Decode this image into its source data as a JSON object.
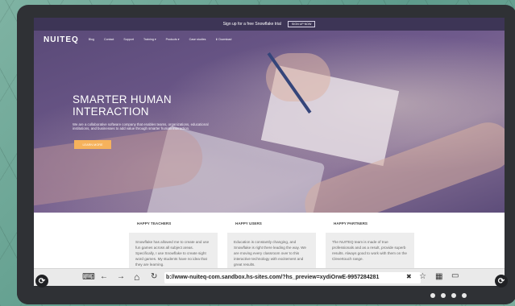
{
  "announcement": {
    "text": "Sign up for a free Snowflake trial",
    "button": "SIGN UP NOW"
  },
  "nav": {
    "logo": "NUITEQ",
    "items": [
      "Blog",
      "Contact",
      "Support",
      "Training ▾",
      "Products ▾",
      "Case studies",
      "⬇ Download"
    ]
  },
  "hero": {
    "title_line1": "SMARTER HUMAN",
    "title_line2": "INTERACTION",
    "description": "We are a collaborative software company that enables teams, organizations, educational institutions, and businesses to add value through smarter human interaction.",
    "cta": "LEARN MORE"
  },
  "cards": [
    {
      "heading": "HAPPY TEACHERS",
      "text": "Snowflake has allowed me to create and use fun games across all subject areas. Specifically, I use Snowflake to create sight word games. My students have no idea that they are learning."
    },
    {
      "heading": "HAPPY USERS",
      "text": "Education is constantly changing, and Snowflake is right there leading the way. We are moving every classroom over to this interactive technology with excitement and great results."
    },
    {
      "heading": "HAPPY PARTNERS",
      "text": "The NUITEQ team is made of true professionals and as a result, provide superb results. Always good to work with them on the Clevertouch range."
    }
  ],
  "browser": {
    "url": "b://www-nuiteq-com.sandbox.hs-sites.com/?hs_preview=xydiOrwE-9957284281",
    "icons": {
      "keyboard": "⌨",
      "back": "←",
      "forward": "→",
      "home": "⌂",
      "refresh": "↻",
      "clear": "✖",
      "bookmark": "☆",
      "apps": "▦",
      "tabs": "▭"
    }
  },
  "side_controls": {
    "left": "⟳",
    "right": "⟳"
  },
  "page_dots": 4
}
